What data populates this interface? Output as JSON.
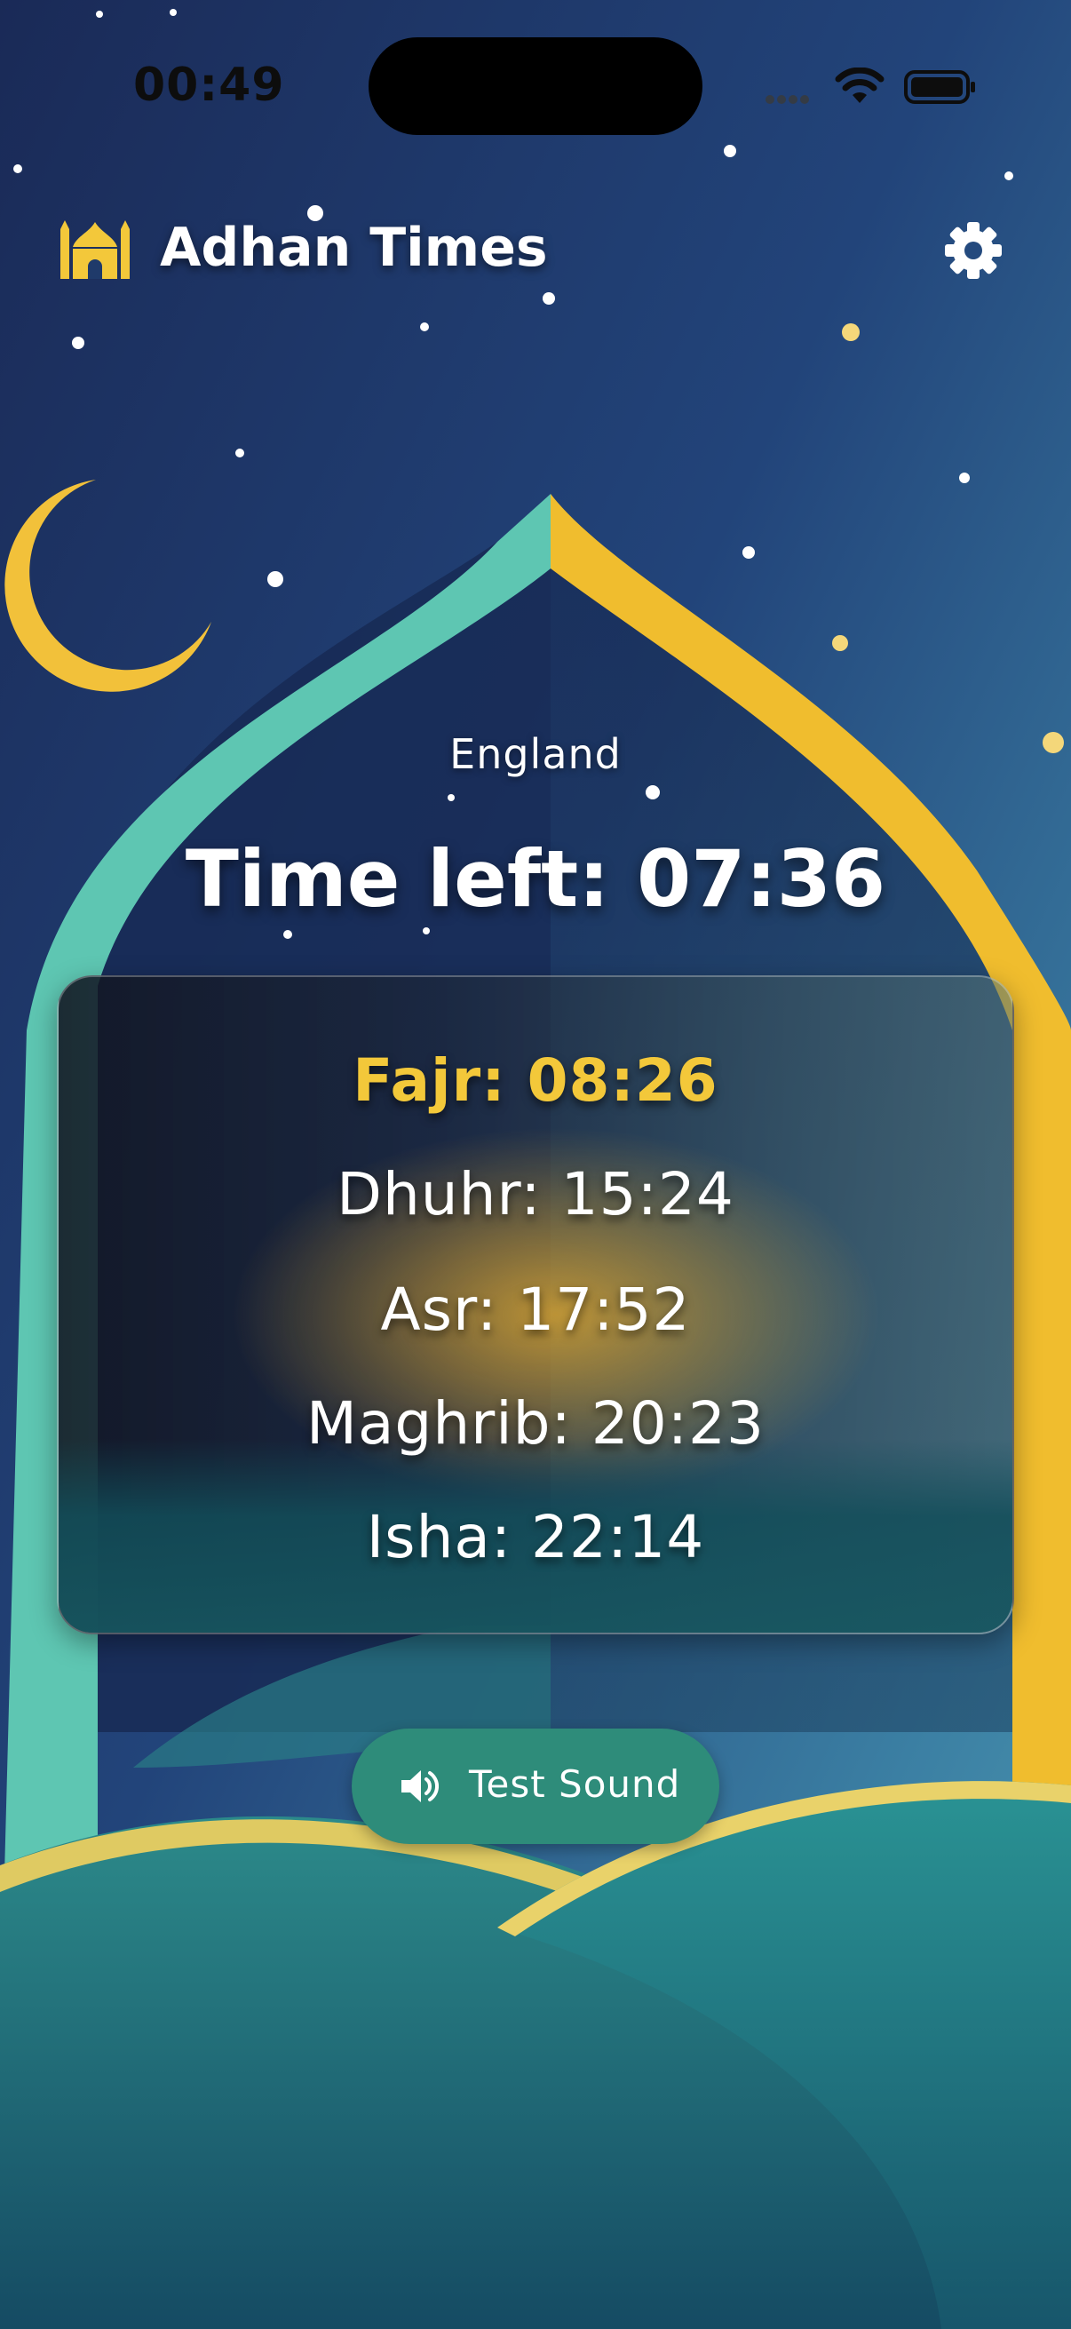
{
  "status_bar": {
    "time": "00:49"
  },
  "header": {
    "title": "Adhan Times",
    "app_icon": "mosque-icon",
    "settings_icon": "gear-icon"
  },
  "location": "England",
  "countdown": {
    "text": "Time left: 07:36"
  },
  "prayers": [
    {
      "text": "Fajr: 08:26",
      "next": true
    },
    {
      "text": "Dhuhr: 15:24"
    },
    {
      "text": "Asr: 17:52"
    },
    {
      "text": "Maghrib: 20:23"
    },
    {
      "text": "Isha: 22:14"
    }
  ],
  "test_button": {
    "label": "Test Sound",
    "icon": "speaker-icon"
  },
  "colors": {
    "accent_gold": "#f3c83a",
    "button_teal": "#2e8c7a",
    "sky_top": "#1b2f5e"
  }
}
